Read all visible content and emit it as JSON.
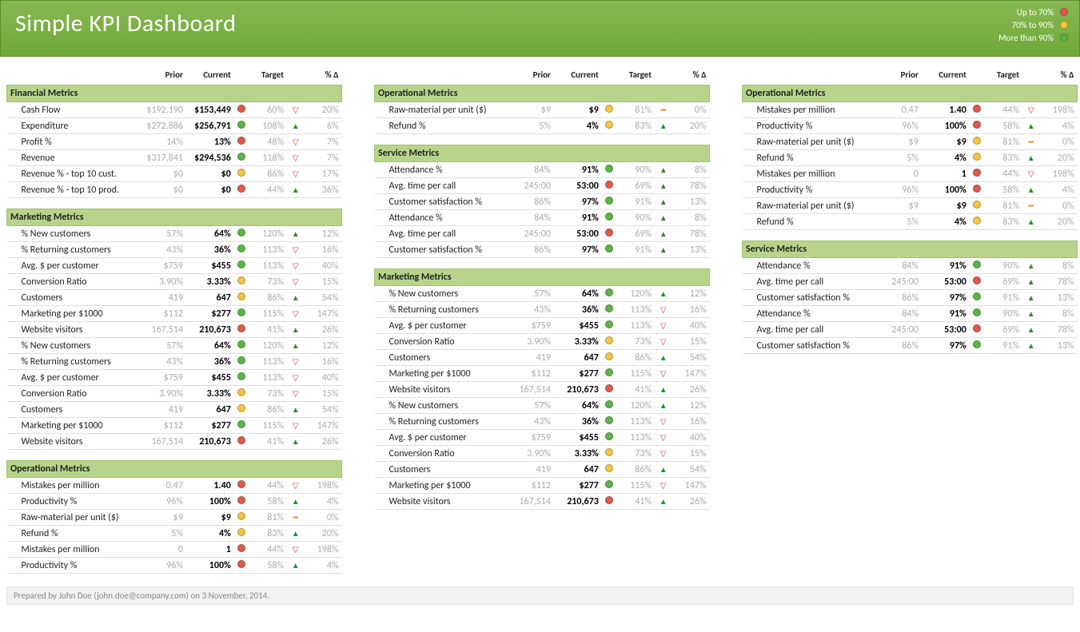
{
  "title": "Simple KPI Dashboard",
  "legend": [
    {
      "label": "Up to 70%",
      "dot": "red"
    },
    {
      "label": "70% to 90%",
      "dot": "yellow"
    },
    {
      "label": "More than 90%",
      "dot": "green"
    }
  ],
  "headers": {
    "prior": "Prior",
    "current": "Current",
    "target": "Target",
    "delta": "% Δ"
  },
  "footer": "Prepared by John Doe (john.doe@company.com) on 3 November, 2014.",
  "columns": [
    [
      {
        "section": "Financial Metrics",
        "rows": [
          {
            "name": "Cash Flow",
            "prior": "$192,190",
            "current": "$153,449",
            "dot": "red",
            "target": "60%",
            "arrow": "down",
            "delta": "20%"
          },
          {
            "name": "Expenditure",
            "prior": "$272,886",
            "current": "$256,791",
            "dot": "green",
            "target": "108%",
            "arrow": "up",
            "delta": "6%"
          },
          {
            "name": "Profit %",
            "prior": "14%",
            "current": "13%",
            "dot": "red",
            "target": "48%",
            "arrow": "down",
            "delta": "7%"
          },
          {
            "name": "Revenue",
            "prior": "$317,841",
            "current": "$294,536",
            "dot": "green",
            "target": "118%",
            "arrow": "down",
            "delta": "7%"
          },
          {
            "name": "Revenue % - top 10 cust.",
            "prior": "$0",
            "current": "$0",
            "dot": "yellow",
            "target": "86%",
            "arrow": "down",
            "delta": "17%"
          },
          {
            "name": "Revenue % - top 10 prod.",
            "prior": "$0",
            "current": "$0",
            "dot": "red",
            "target": "44%",
            "arrow": "up",
            "delta": "36%"
          }
        ]
      },
      {
        "section": "Marketing Metrics",
        "rows": [
          {
            "name": "% New customers",
            "prior": "57%",
            "current": "64%",
            "dot": "green",
            "target": "120%",
            "arrow": "up",
            "delta": "12%"
          },
          {
            "name": "% Returning customers",
            "prior": "43%",
            "current": "36%",
            "dot": "green",
            "target": "113%",
            "arrow": "down",
            "delta": "16%"
          },
          {
            "name": "Avg. $ per customer",
            "prior": "$759",
            "current": "$455",
            "dot": "green",
            "target": "113%",
            "arrow": "down",
            "delta": "40%"
          },
          {
            "name": "Conversion Ratio",
            "prior": "3.90%",
            "current": "3.33%",
            "dot": "yellow",
            "target": "73%",
            "arrow": "down",
            "delta": "15%"
          },
          {
            "name": "Customers",
            "prior": "419",
            "current": "647",
            "dot": "yellow",
            "target": "86%",
            "arrow": "up",
            "delta": "54%"
          },
          {
            "name": "Marketing per $1000",
            "prior": "$112",
            "current": "$277",
            "dot": "green",
            "target": "115%",
            "arrow": "down",
            "delta": "147%"
          },
          {
            "name": "Website visitors",
            "prior": "167,514",
            "current": "210,673",
            "dot": "red",
            "target": "41%",
            "arrow": "up",
            "delta": "26%"
          },
          {
            "name": "% New customers",
            "prior": "57%",
            "current": "64%",
            "dot": "green",
            "target": "120%",
            "arrow": "up",
            "delta": "12%"
          },
          {
            "name": "% Returning customers",
            "prior": "43%",
            "current": "36%",
            "dot": "green",
            "target": "113%",
            "arrow": "down",
            "delta": "16%"
          },
          {
            "name": "Avg. $ per customer",
            "prior": "$759",
            "current": "$455",
            "dot": "green",
            "target": "113%",
            "arrow": "down",
            "delta": "40%"
          },
          {
            "name": "Conversion Ratio",
            "prior": "3.90%",
            "current": "3.33%",
            "dot": "yellow",
            "target": "73%",
            "arrow": "down",
            "delta": "15%"
          },
          {
            "name": "Customers",
            "prior": "419",
            "current": "647",
            "dot": "yellow",
            "target": "86%",
            "arrow": "up",
            "delta": "54%"
          },
          {
            "name": "Marketing per $1000",
            "prior": "$112",
            "current": "$277",
            "dot": "green",
            "target": "115%",
            "arrow": "down",
            "delta": "147%"
          },
          {
            "name": "Website visitors",
            "prior": "167,514",
            "current": "210,673",
            "dot": "red",
            "target": "41%",
            "arrow": "up",
            "delta": "26%"
          }
        ]
      },
      {
        "section": "Operational Metrics",
        "rows": [
          {
            "name": "Mistakes per million",
            "prior": "0.47",
            "current": "1.40",
            "dot": "red",
            "target": "44%",
            "arrow": "down",
            "delta": "198%"
          },
          {
            "name": "Productivity %",
            "prior": "96%",
            "current": "100%",
            "dot": "red",
            "target": "58%",
            "arrow": "up",
            "delta": "4%"
          },
          {
            "name": "Raw-material per unit ($)",
            "prior": "$9",
            "current": "$9",
            "dot": "yellow",
            "target": "81%",
            "arrow": "flat",
            "delta": "0%"
          },
          {
            "name": "Refund %",
            "prior": "5%",
            "current": "4%",
            "dot": "yellow",
            "target": "83%",
            "arrow": "up",
            "delta": "20%"
          },
          {
            "name": "Mistakes per million",
            "prior": "0",
            "current": "1",
            "dot": "red",
            "target": "44%",
            "arrow": "down",
            "delta": "198%"
          },
          {
            "name": "Productivity %",
            "prior": "96%",
            "current": "100%",
            "dot": "red",
            "target": "58%",
            "arrow": "up",
            "delta": "4%"
          }
        ]
      }
    ],
    [
      {
        "section": "Operational Metrics",
        "rows": [
          {
            "name": "Raw-material per unit ($)",
            "prior": "$9",
            "current": "$9",
            "dot": "yellow",
            "target": "81%",
            "arrow": "flat",
            "delta": "0%"
          },
          {
            "name": "Refund %",
            "prior": "5%",
            "current": "4%",
            "dot": "yellow",
            "target": "83%",
            "arrow": "up",
            "delta": "20%"
          }
        ]
      },
      {
        "section": "Service Metrics",
        "rows": [
          {
            "name": "Attendance %",
            "prior": "84%",
            "current": "91%",
            "dot": "green",
            "target": "90%",
            "arrow": "up",
            "delta": "8%"
          },
          {
            "name": "Avg. time per call",
            "prior": "245:00",
            "current": "53:00",
            "dot": "red",
            "target": "69%",
            "arrow": "up",
            "delta": "78%"
          },
          {
            "name": "Customer satisfaction %",
            "prior": "86%",
            "current": "97%",
            "dot": "green",
            "target": "91%",
            "arrow": "up",
            "delta": "13%"
          },
          {
            "name": "Attendance %",
            "prior": "84%",
            "current": "91%",
            "dot": "green",
            "target": "90%",
            "arrow": "up",
            "delta": "8%"
          },
          {
            "name": "Avg. time per call",
            "prior": "245:00",
            "current": "53:00",
            "dot": "red",
            "target": "69%",
            "arrow": "up",
            "delta": "78%"
          },
          {
            "name": "Customer satisfaction %",
            "prior": "86%",
            "current": "97%",
            "dot": "green",
            "target": "91%",
            "arrow": "up",
            "delta": "13%"
          }
        ]
      },
      {
        "section": "Marketing Metrics",
        "rows": [
          {
            "name": "% New customers",
            "prior": "57%",
            "current": "64%",
            "dot": "green",
            "target": "120%",
            "arrow": "up",
            "delta": "12%"
          },
          {
            "name": "% Returning customers",
            "prior": "43%",
            "current": "36%",
            "dot": "green",
            "target": "113%",
            "arrow": "down",
            "delta": "16%"
          },
          {
            "name": "Avg. $ per customer",
            "prior": "$759",
            "current": "$455",
            "dot": "green",
            "target": "113%",
            "arrow": "down",
            "delta": "40%"
          },
          {
            "name": "Conversion Ratio",
            "prior": "3.90%",
            "current": "3.33%",
            "dot": "yellow",
            "target": "73%",
            "arrow": "down",
            "delta": "15%"
          },
          {
            "name": "Customers",
            "prior": "419",
            "current": "647",
            "dot": "yellow",
            "target": "86%",
            "arrow": "up",
            "delta": "54%"
          },
          {
            "name": "Marketing per $1000",
            "prior": "$112",
            "current": "$277",
            "dot": "green",
            "target": "115%",
            "arrow": "down",
            "delta": "147%"
          },
          {
            "name": "Website visitors",
            "prior": "167,514",
            "current": "210,673",
            "dot": "red",
            "target": "41%",
            "arrow": "up",
            "delta": "26%"
          },
          {
            "name": "% New customers",
            "prior": "57%",
            "current": "64%",
            "dot": "green",
            "target": "120%",
            "arrow": "up",
            "delta": "12%"
          },
          {
            "name": "% Returning customers",
            "prior": "43%",
            "current": "36%",
            "dot": "green",
            "target": "113%",
            "arrow": "down",
            "delta": "16%"
          },
          {
            "name": "Avg. $ per customer",
            "prior": "$759",
            "current": "$455",
            "dot": "green",
            "target": "113%",
            "arrow": "down",
            "delta": "40%"
          },
          {
            "name": "Conversion Ratio",
            "prior": "3.90%",
            "current": "3.33%",
            "dot": "yellow",
            "target": "73%",
            "arrow": "down",
            "delta": "15%"
          },
          {
            "name": "Customers",
            "prior": "419",
            "current": "647",
            "dot": "yellow",
            "target": "86%",
            "arrow": "up",
            "delta": "54%"
          },
          {
            "name": "Marketing per $1000",
            "prior": "$112",
            "current": "$277",
            "dot": "green",
            "target": "115%",
            "arrow": "down",
            "delta": "147%"
          },
          {
            "name": "Website visitors",
            "prior": "167,514",
            "current": "210,673",
            "dot": "red",
            "target": "41%",
            "arrow": "up",
            "delta": "26%"
          }
        ]
      }
    ],
    [
      {
        "section": "Operational Metrics",
        "rows": [
          {
            "name": "Mistakes per million",
            "prior": "0.47",
            "current": "1.40",
            "dot": "red",
            "target": "44%",
            "arrow": "down",
            "delta": "198%"
          },
          {
            "name": "Productivity %",
            "prior": "96%",
            "current": "100%",
            "dot": "red",
            "target": "58%",
            "arrow": "up",
            "delta": "4%"
          },
          {
            "name": "Raw-material per unit ($)",
            "prior": "$9",
            "current": "$9",
            "dot": "yellow",
            "target": "81%",
            "arrow": "flat",
            "delta": "0%"
          },
          {
            "name": "Refund %",
            "prior": "5%",
            "current": "4%",
            "dot": "yellow",
            "target": "83%",
            "arrow": "up",
            "delta": "20%"
          },
          {
            "name": "Mistakes per million",
            "prior": "0",
            "current": "1",
            "dot": "red",
            "target": "44%",
            "arrow": "down",
            "delta": "198%"
          },
          {
            "name": "Productivity %",
            "prior": "96%",
            "current": "100%",
            "dot": "red",
            "target": "58%",
            "arrow": "up",
            "delta": "4%"
          },
          {
            "name": "Raw-material per unit ($)",
            "prior": "$9",
            "current": "$9",
            "dot": "yellow",
            "target": "81%",
            "arrow": "flat",
            "delta": "0%"
          },
          {
            "name": "Refund %",
            "prior": "5%",
            "current": "4%",
            "dot": "yellow",
            "target": "83%",
            "arrow": "up",
            "delta": "20%"
          }
        ]
      },
      {
        "section": "Service Metrics",
        "rows": [
          {
            "name": "Attendance %",
            "prior": "84%",
            "current": "91%",
            "dot": "green",
            "target": "90%",
            "arrow": "up",
            "delta": "8%"
          },
          {
            "name": "Avg. time per call",
            "prior": "245:00",
            "current": "53:00",
            "dot": "red",
            "target": "69%",
            "arrow": "up",
            "delta": "78%"
          },
          {
            "name": "Customer satisfaction %",
            "prior": "86%",
            "current": "97%",
            "dot": "green",
            "target": "91%",
            "arrow": "up",
            "delta": "13%"
          },
          {
            "name": "Attendance %",
            "prior": "84%",
            "current": "91%",
            "dot": "green",
            "target": "90%",
            "arrow": "up",
            "delta": "8%"
          },
          {
            "name": "Avg. time per call",
            "prior": "245:00",
            "current": "53:00",
            "dot": "red",
            "target": "69%",
            "arrow": "up",
            "delta": "78%"
          },
          {
            "name": "Customer satisfaction %",
            "prior": "86%",
            "current": "97%",
            "dot": "green",
            "target": "91%",
            "arrow": "up",
            "delta": "13%"
          }
        ]
      }
    ]
  ]
}
